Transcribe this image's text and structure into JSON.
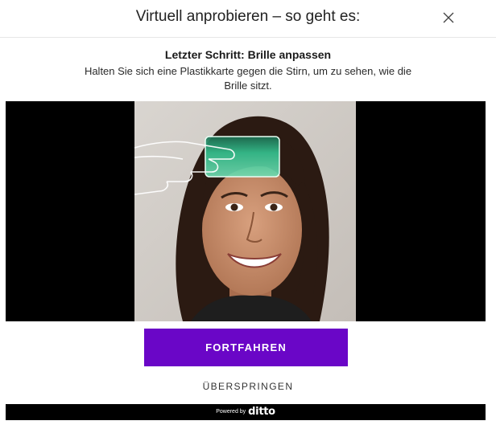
{
  "header": {
    "title": "Virtuell anprobieren – so geht es:",
    "close_icon": "close-icon"
  },
  "instructions": {
    "title": "Letzter Schritt: Brille anpassen",
    "description": "Halten Sie sich eine Plastikkarte gegen die Stirn, um zu sehen, wie die Brille sitzt."
  },
  "preview": {
    "photo_icon": "woman-portrait-with-card-illustration",
    "card_color": "#2fbf8a",
    "hand_icon": "hand-outline-icon"
  },
  "actions": {
    "continue_label": "FORTFAHREN",
    "skip_label": "ÜBERSPRINGEN",
    "accent_color": "#6a06c7"
  },
  "footer": {
    "powered_by": "Powered by",
    "brand": "ditto"
  }
}
